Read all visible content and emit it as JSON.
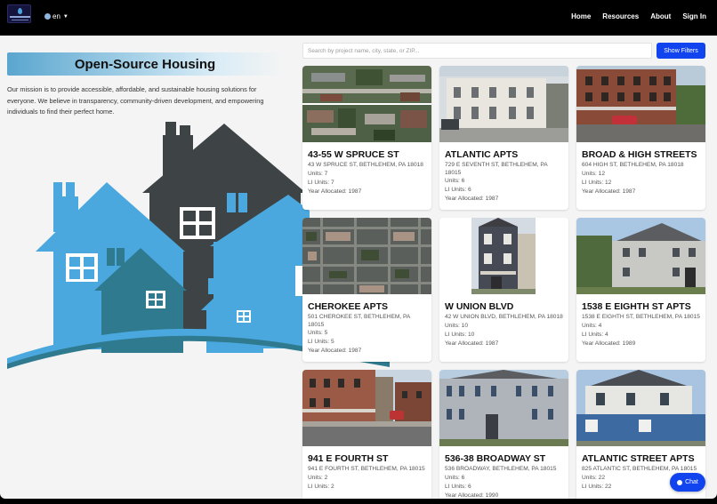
{
  "header": {
    "logo_alt": "Open-Source Housing logo",
    "language": "en",
    "language_caret": "▼",
    "nav": [
      "Home",
      "Resources",
      "About",
      "Sign In"
    ]
  },
  "hero": {
    "title": "Open-Source Housing",
    "mission": "Our mission is to provide accessible, affordable, and sustainable housing solutions for everyone. We believe in transparency, community-driven development, and empowering individuals to find their perfect home."
  },
  "search": {
    "placeholder": "Search by project name, city, state, or ZIP...",
    "value": "",
    "filters_label": "Show Filters"
  },
  "listings": [
    {
      "name": "43-55 W SPRUCE ST",
      "address": "43 W SPRUCE ST, BETHLEHEM, PA 18018",
      "units": "Units: 7",
      "li_units": "LI Units: 7",
      "year": "Year Allocated: 1987",
      "photo": "aerial-split"
    },
    {
      "name": "ATLANTIC APTS",
      "address": "729 E SEVENTH ST, BETHLEHEM, PA 18015",
      "units": "Units: 6",
      "li_units": "LI Units: 6",
      "year": "Year Allocated: 1987",
      "photo": "white-row"
    },
    {
      "name": "BROAD & HIGH STREETS",
      "address": "604 HIGH ST, BETHLEHEM, PA 18018",
      "units": "Units: 12",
      "li_units": "LI Units: 12",
      "year": "Year Allocated: 1987",
      "photo": "brick-corner"
    },
    {
      "name": "CHEROKEE APTS",
      "address": "501 CHEROKEE ST, BETHLEHEM, PA 18015",
      "units": "Units: 5",
      "li_units": "LI Units: 5",
      "year": "Year Allocated: 1987",
      "photo": "aerial"
    },
    {
      "name": "W UNION BLVD",
      "address": "42 W UNION BLVD, BETHLEHEM, PA 18018",
      "units": "Units: 10",
      "li_units": "LI Units: 10",
      "year": "Year Allocated: 1987",
      "photo": "tall-house"
    },
    {
      "name": "1538 E EIGHTH ST APTS",
      "address": "1538 E EIGHTH ST, BETHLEHEM, PA 18015",
      "units": "Units: 4",
      "li_units": "LI Units: 4",
      "year": "Year Allocated: 1989",
      "photo": "siding-house"
    },
    {
      "name": "941 E FOURTH ST",
      "address": "941 E FOURTH ST, BETHLEHEM, PA 18015",
      "units": "Units: 2",
      "li_units": "LI Units: 2",
      "year": "",
      "photo": "street-row"
    },
    {
      "name": "536-38 BROADWAY ST",
      "address": "536 BROADWAY, BETHLEHEM, PA 18015",
      "units": "Units: 6",
      "li_units": "LI Units: 6",
      "year": "Year Allocated: 1990",
      "photo": "gray-duplex"
    },
    {
      "name": "ATLANTIC STREET APTS",
      "address": "825 ATLANTIC ST, BETHLEHEM, PA 18015",
      "units": "Units: 22",
      "li_units": "LI Units: 22",
      "year": "",
      "photo": "blue-house"
    }
  ],
  "chat": {
    "label": "Chat"
  },
  "colors": {
    "accent": "#1144ee",
    "house_blue": "#4aa8df",
    "house_teal": "#2f7a8f",
    "house_dark": "#3e4446"
  }
}
